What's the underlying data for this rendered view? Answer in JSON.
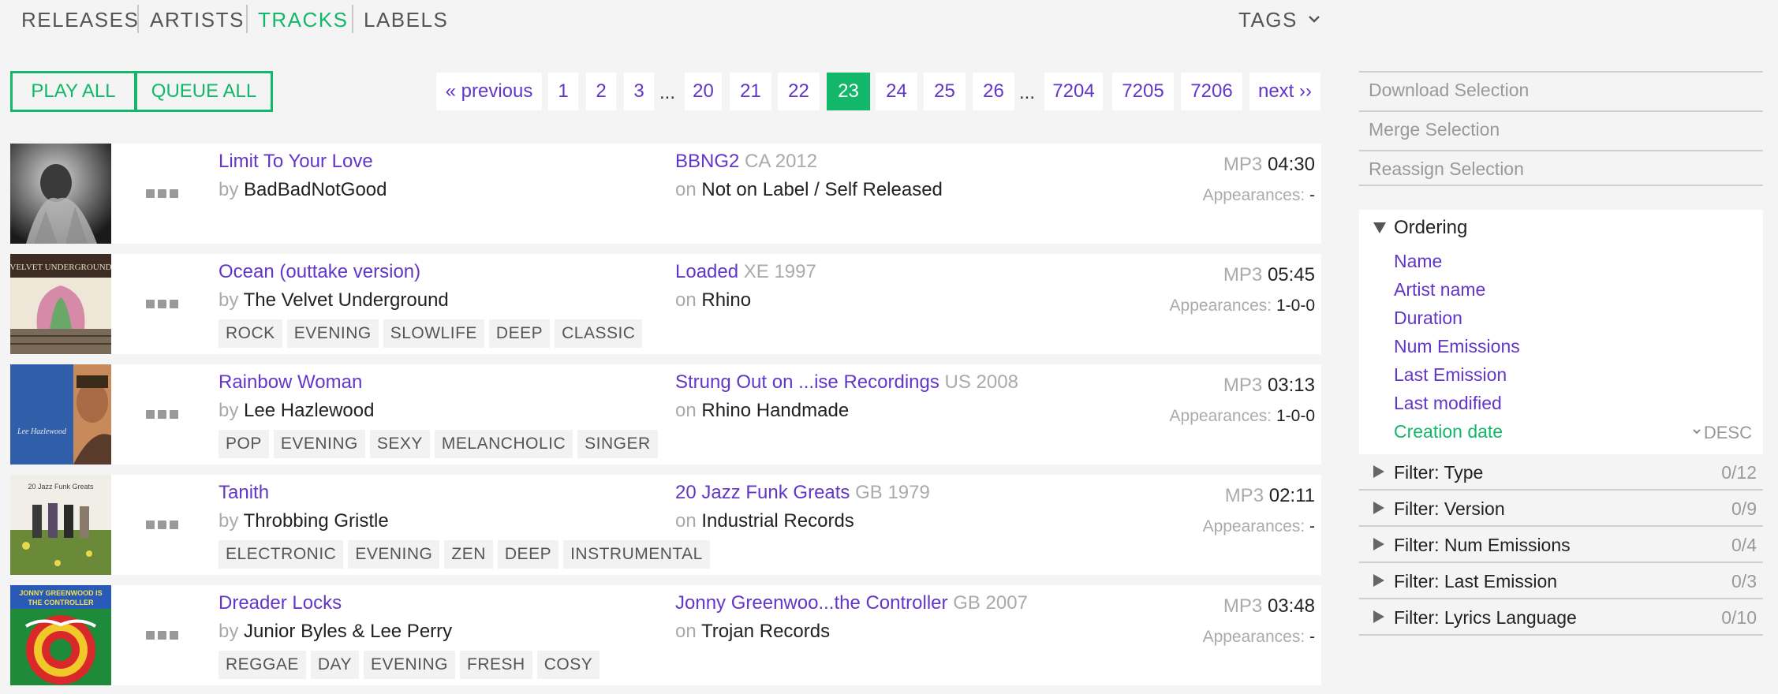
{
  "nav": {
    "items": [
      {
        "label": "RELEASES",
        "active": false
      },
      {
        "label": "ARTISTS",
        "active": false
      },
      {
        "label": "TRACKS",
        "active": true
      },
      {
        "label": "LABELS",
        "active": false
      }
    ],
    "tags_label": "TAGS"
  },
  "actions": {
    "play_all": "PLAY ALL",
    "queue_all": "QUEUE ALL"
  },
  "pagination": {
    "previous": "« previous",
    "next": "next ››",
    "ellipsis": "...",
    "pages": [
      "1",
      "2",
      "3",
      "20",
      "21",
      "22",
      "23",
      "24",
      "25",
      "26",
      "7204",
      "7205",
      "7206"
    ],
    "current": "23"
  },
  "tracks": [
    {
      "title": "Limit To Your Love",
      "by": "by",
      "artist": "BadBadNotGood",
      "release": "BBNG2",
      "country_year": "CA 2012",
      "on": "on",
      "label": "Not on Label / Self Released",
      "format": "MP3",
      "duration": "04:30",
      "appearances_label": "Appearances:",
      "appearances": "-",
      "tags": []
    },
    {
      "title": "Ocean (outtake version)",
      "by": "by",
      "artist": "The Velvet Underground",
      "release": "Loaded",
      "country_year": "XE 1997",
      "on": "on",
      "label": "Rhino",
      "format": "MP3",
      "duration": "05:45",
      "appearances_label": "Appearances:",
      "appearances": "1-0-0",
      "tags": [
        "ROCK",
        "EVENING",
        "SLOWLIFE",
        "DEEP",
        "CLASSIC"
      ]
    },
    {
      "title": "Rainbow Woman",
      "by": "by",
      "artist": "Lee Hazlewood",
      "release": "Strung Out on ...ise Recordings",
      "country_year": "US 2008",
      "on": "on",
      "label": "Rhino Handmade",
      "format": "MP3",
      "duration": "03:13",
      "appearances_label": "Appearances:",
      "appearances": "1-0-0",
      "tags": [
        "POP",
        "EVENING",
        "SEXY",
        "MELANCHOLIC",
        "SINGER"
      ]
    },
    {
      "title": "Tanith",
      "by": "by",
      "artist": "Throbbing Gristle",
      "release": "20 Jazz Funk Greats",
      "country_year": "GB 1979",
      "on": "on",
      "label": "Industrial Records",
      "format": "MP3",
      "duration": "02:11",
      "appearances_label": "Appearances:",
      "appearances": "-",
      "tags": [
        "ELECTRONIC",
        "EVENING",
        "ZEN",
        "DEEP",
        "INSTRUMENTAL"
      ]
    },
    {
      "title": "Dreader Locks",
      "by": "by",
      "artist": "Junior Byles & Lee Perry",
      "release": "Jonny Greenwoo...the Controller",
      "country_year": "GB 2007",
      "on": "on",
      "label": "Trojan Records",
      "format": "MP3",
      "duration": "03:48",
      "appearances_label": "Appearances:",
      "appearances": "-",
      "tags": [
        "REGGAE",
        "DAY",
        "EVENING",
        "FRESH",
        "COSY"
      ]
    }
  ],
  "sidebar": {
    "selection_actions": [
      "Download Selection",
      "Merge Selection",
      "Reassign Selection"
    ],
    "ordering": {
      "title": "Ordering",
      "options": [
        "Name",
        "Artist name",
        "Duration",
        "Num Emissions",
        "Last Emission",
        "Last modified",
        "Creation date"
      ],
      "active": "Creation date",
      "direction": "DESC"
    },
    "filters": [
      {
        "label": "Filter: Type",
        "count": "0/12"
      },
      {
        "label": "Filter: Version",
        "count": "0/9"
      },
      {
        "label": "Filter: Num Emissions",
        "count": "0/4"
      },
      {
        "label": "Filter: Last Emission",
        "count": "0/3"
      },
      {
        "label": "Filter: Lyrics Language",
        "count": "0/10"
      }
    ]
  },
  "colors": {
    "accent_green": "#12b76a",
    "link_purple": "#6236c9",
    "muted": "#aaaaaa"
  }
}
